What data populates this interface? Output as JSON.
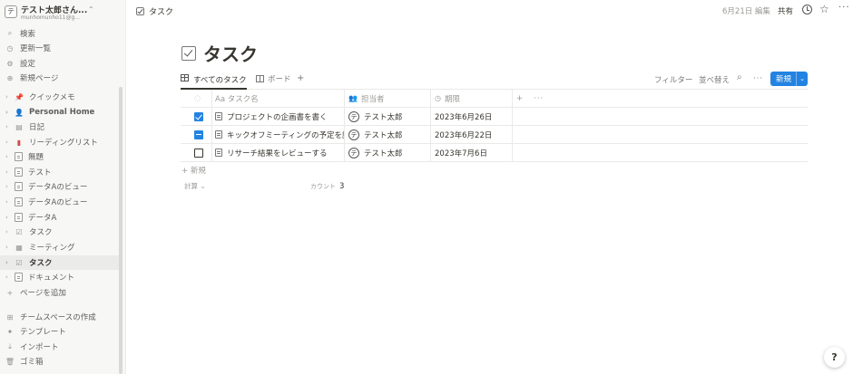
{
  "workspace": {
    "avatar": "テ",
    "name": "テスト太郎さん...",
    "email": "munhomunho11@g..."
  },
  "nav": [
    {
      "label": "検索",
      "icon": "search-icon"
    },
    {
      "label": "更新一覧",
      "icon": "clock-icon"
    },
    {
      "label": "設定",
      "icon": "gear-icon"
    },
    {
      "label": "新規ページ",
      "icon": "plus-circle-icon"
    }
  ],
  "pages": [
    {
      "label": "クイックメモ",
      "icon": "pin-icon"
    },
    {
      "label": "Personal Home",
      "icon": "person-icon"
    },
    {
      "label": "日記",
      "icon": "book-icon"
    },
    {
      "label": "リーディングリスト",
      "icon": "book-red-icon"
    },
    {
      "label": "無題",
      "icon": "page-icon"
    },
    {
      "label": "テスト",
      "icon": "page-icon"
    },
    {
      "label": "データAのビュー",
      "icon": "page-icon"
    },
    {
      "label": "データAのビュー",
      "icon": "page-icon"
    },
    {
      "label": "データA",
      "icon": "page-icon"
    },
    {
      "label": "タスク",
      "icon": "checkbox-icon"
    },
    {
      "label": "ミーティング",
      "icon": "calendar-icon"
    },
    {
      "label": "タスク",
      "icon": "checkbox-icon"
    },
    {
      "label": "ドキュメント",
      "icon": "page-icon"
    }
  ],
  "add_page": "ページを追加",
  "bottom_nav": [
    {
      "label": "チームスペースの作成",
      "icon": "team-icon"
    },
    {
      "label": "テンプレート",
      "icon": "template-icon"
    },
    {
      "label": "インポート",
      "icon": "import-icon"
    },
    {
      "label": "ゴミ箱",
      "icon": "trash-icon"
    }
  ],
  "topbar": {
    "breadcrumb": "タスク",
    "edited": "6月21日 編集",
    "share": "共有"
  },
  "page_title": "タスク",
  "views": {
    "all_tasks": "すべてのタスク",
    "board": "ボード",
    "add": "+",
    "filter": "フィルター",
    "sort": "並べ替え",
    "new": "新規"
  },
  "columns": {
    "name": "Aa タスク名",
    "assignee": "担当者",
    "due": "期限"
  },
  "rows": [
    {
      "status": "checked",
      "name": "プロジェクトの企画書を書く",
      "assignee": "テスト太郎",
      "due": "2023年6月26日"
    },
    {
      "status": "mixed",
      "name": "キックオフミーティングの予定を調整",
      "assignee": "テスト太郎",
      "due": "2023年6月22日"
    },
    {
      "status": "unchecked",
      "name": "リサーチ結果をレビューする",
      "assignee": "テスト太郎",
      "due": "2023年7月6日"
    }
  ],
  "new_row": "+ 新規",
  "calc": "計算",
  "count_label": "カウント",
  "count_value": "3",
  "help": "?"
}
